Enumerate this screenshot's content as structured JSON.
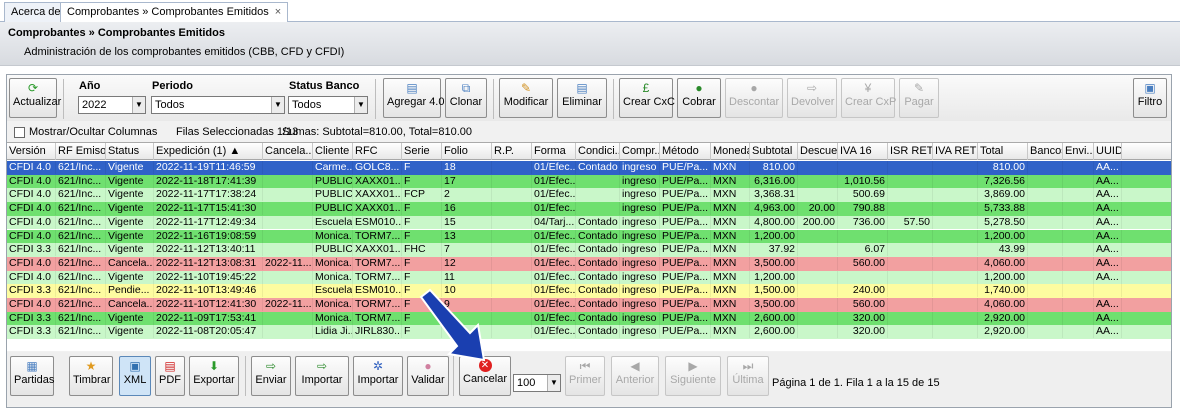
{
  "tabs": [
    {
      "label": "Acerca de"
    },
    {
      "label": "Comprobantes » Comprobantes Emitidos",
      "close": "×"
    }
  ],
  "panel": {
    "title": "Comprobantes » Comprobantes Emitidos",
    "subtitle": "Administración de los comprobantes emitidos (CBB, CFD y CFDI)"
  },
  "toolbar": {
    "actualizar": "Actualizar",
    "anio_label": "Año",
    "anio_value": "2022",
    "periodo_label": "Periodo",
    "periodo_value": "Todos",
    "status_label": "Status Banco",
    "status_value": "Todos",
    "agregar": "Agregar 4.0",
    "clonar": "Clonar",
    "modificar": "Modificar",
    "eliminar": "Eliminar",
    "crear_cxc": "Crear CxC",
    "cobrar": "Cobrar",
    "descontar": "Descontar",
    "devolver": "Devolver",
    "crear_cxp": "Crear CxP",
    "pagar": "Pagar",
    "filtro": "Filtro"
  },
  "info": {
    "mostrar": "Mostrar/Ocultar Columnas",
    "seleccionadas": "Filas Seleccionadas  1/13",
    "sumas": "Sumas:  Subtotal=810.00, Total=810.00"
  },
  "columns": [
    "Versión",
    "RF Emisor",
    "Status",
    "Expedición (1) ▲",
    "Cancela...",
    "Cliente",
    "RFC",
    "Serie",
    "Folio",
    "R.P.",
    "Forma",
    "Condici...",
    "Compr...",
    "Método",
    "Moneda",
    "Subtotal",
    "Descue...",
    "IVA 16",
    "ISR RET",
    "IVA RET",
    "Total",
    "Bancos",
    "Envi...",
    "UUID"
  ],
  "rows": [
    {
      "c": [
        "CFDI 4.0",
        "621/Inc...",
        "Vigente",
        "2022-11-19T11:46:59",
        "",
        "Carme...",
        "GOLC8...",
        "F",
        "18",
        "",
        "01/Efec...",
        "Contado",
        "ingreso",
        "PUE/Pa...",
        "MXN",
        "810.00",
        "",
        "",
        "",
        "",
        "810.00",
        "",
        "",
        "AA..."
      ],
      "state": "selected"
    },
    {
      "c": [
        "CFDI 4.0",
        "621/Inc...",
        "Vigente",
        "2022-11-18T17:41:39",
        "",
        "PUBLIC...",
        "XAXX01...",
        "F",
        "17",
        "",
        "01/Efec...",
        "",
        "ingreso",
        "PUE/Pa...",
        "MXN",
        "6,316.00",
        "",
        "1,010.56",
        "",
        "",
        "7,326.56",
        "",
        "",
        "AA..."
      ],
      "state": "green"
    },
    {
      "c": [
        "CFDI 4.0",
        "621/Inc...",
        "Vigente",
        "2022-11-17T17:38:24",
        "",
        "PUBLIC...",
        "XAXX01...",
        "FCP",
        "2",
        "",
        "01/Efec...",
        "",
        "ingreso",
        "PUE/Pa...",
        "MXN",
        "3,368.31",
        "",
        "500.69",
        "",
        "",
        "3,869.00",
        "",
        "",
        "AA..."
      ],
      "state": "lightgreen"
    },
    {
      "c": [
        "CFDI 4.0",
        "621/Inc...",
        "Vigente",
        "2022-11-17T15:41:30",
        "",
        "PUBLIC...",
        "XAXX01...",
        "F",
        "16",
        "",
        "01/Efec...",
        "",
        "ingreso",
        "PUE/Pa...",
        "MXN",
        "4,963.00",
        "20.00",
        "790.88",
        "",
        "",
        "5,733.88",
        "",
        "",
        "AA..."
      ],
      "state": "green"
    },
    {
      "c": [
        "CFDI 4.0",
        "621/Inc...",
        "Vigente",
        "2022-11-17T12:49:34",
        "",
        "Escuela...",
        "ESM010...",
        "F",
        "15",
        "",
        "04/Tarj...",
        "Contado",
        "ingreso",
        "PUE/Pa...",
        "MXN",
        "4,800.00",
        "200.00",
        "736.00",
        "57.50",
        "",
        "5,278.50",
        "",
        "",
        "AA..."
      ],
      "state": "lightgreen"
    },
    {
      "c": [
        "CFDI 4.0",
        "621/Inc...",
        "Vigente",
        "2022-11-16T19:08:59",
        "",
        "Monica...",
        "TORM7...",
        "F",
        "13",
        "",
        "01/Efec...",
        "Contado",
        "ingreso",
        "PUE/Pa...",
        "MXN",
        "1,200.00",
        "",
        "",
        "",
        "",
        "1,200.00",
        "",
        "",
        "AA..."
      ],
      "state": "green"
    },
    {
      "c": [
        "CFDI 3.3",
        "621/Inc...",
        "Vigente",
        "2022-11-12T13:40:11",
        "",
        "PUBLIC...",
        "XAXX01...",
        "FHC",
        "7",
        "",
        "01/Efec...",
        "Contado",
        "ingreso",
        "PUE/Pa...",
        "MXN",
        "37.92",
        "",
        "6.07",
        "",
        "",
        "43.99",
        "",
        "",
        "AA..."
      ],
      "state": "lightgreen"
    },
    {
      "c": [
        "CFDI 4.0",
        "621/Inc...",
        "Cancela...",
        "2022-11-12T13:08:31",
        "2022-11...",
        "Monica...",
        "TORM7...",
        "F",
        "12",
        "",
        "01/Efec...",
        "Contado",
        "ingreso",
        "PUE/Pa...",
        "MXN",
        "3,500.00",
        "",
        "560.00",
        "",
        "",
        "4,060.00",
        "",
        "",
        "AA..."
      ],
      "state": "red"
    },
    {
      "c": [
        "CFDI 4.0",
        "621/Inc...",
        "Vigente",
        "2022-11-10T19:45:22",
        "",
        "Monica...",
        "TORM7...",
        "F",
        "11",
        "",
        "01/Efec...",
        "Contado",
        "ingreso",
        "PUE/Pa...",
        "MXN",
        "1,200.00",
        "",
        "",
        "",
        "",
        "1,200.00",
        "",
        "",
        "AA..."
      ],
      "state": "lightgreen"
    },
    {
      "c": [
        "CFDI 3.3",
        "621/Inc...",
        "Pendie...",
        "2022-11-10T13:49:46",
        "",
        "Escuela...",
        "ESM010...",
        "F",
        "10",
        "",
        "01/Efec...",
        "Contado",
        "ingreso",
        "PUE/Pa...",
        "MXN",
        "1,500.00",
        "",
        "240.00",
        "",
        "",
        "1,740.00",
        "",
        "",
        ""
      ],
      "state": "yellow"
    },
    {
      "c": [
        "CFDI 4.0",
        "621/Inc...",
        "Cancela...",
        "2022-11-10T12:41:30",
        "2022-11...",
        "Monica...",
        "TORM7...",
        "F",
        "9",
        "",
        "01/Efec...",
        "Contado",
        "ingreso",
        "PUE/Pa...",
        "MXN",
        "3,500.00",
        "",
        "560.00",
        "",
        "",
        "4,060.00",
        "",
        "",
        "AA..."
      ],
      "state": "red"
    },
    {
      "c": [
        "CFDI 3.3",
        "621/Inc...",
        "Vigente",
        "2022-11-09T17:53:41",
        "",
        "Monica...",
        "TORM7...",
        "F",
        "",
        "",
        "01/Efec...",
        "Contado",
        "ingreso",
        "PUE/Pa...",
        "MXN",
        "2,600.00",
        "",
        "320.00",
        "",
        "",
        "2,920.00",
        "",
        "",
        "AA..."
      ],
      "state": "green"
    },
    {
      "c": [
        "CFDI 3.3",
        "621/Inc...",
        "Vigente",
        "2022-11-08T20:05:47",
        "",
        "Lidia Ji...",
        "JIRL830...",
        "F",
        "",
        "",
        "01/Efec...",
        "Contado",
        "ingreso",
        "PUE/Pa...",
        "MXN",
        "2,600.00",
        "",
        "320.00",
        "",
        "",
        "2,920.00",
        "",
        "",
        "AA..."
      ],
      "state": "lightgreen"
    }
  ],
  "bottom": {
    "partidas": "Partidas",
    "timbrar": "Timbrar",
    "xml": "XML",
    "pdf": "PDF",
    "exportar": "Exportar",
    "enviar": "Enviar",
    "importar1": "Importar",
    "importar2": "Importar",
    "validar": "Validar",
    "cancelar": "Cancelar",
    "pagesize": "100",
    "primer": "Primer",
    "anterior": "Anterior",
    "siguiente": "Siguiente",
    "ultima": "Última",
    "pagina": "Página 1 de 1. Fila 1 a la 15 de 15"
  },
  "colors": {
    "selected": "#3062c8",
    "green": "#6fe06f",
    "lightgreen": "#c9f7c9",
    "red": "#f2a0a0",
    "yellow": "#fdfca0",
    "accent": "#1f4fbf",
    "cancel_icon": "#e02020"
  }
}
